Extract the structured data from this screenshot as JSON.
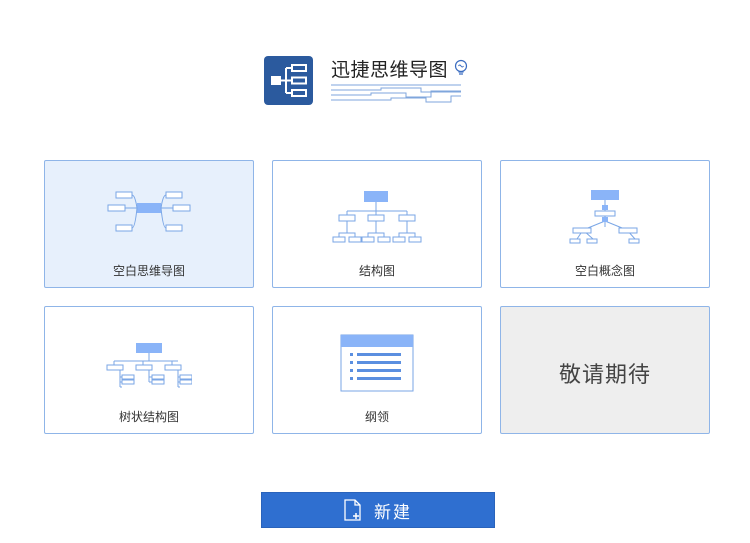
{
  "app": {
    "title": "迅捷思维导图"
  },
  "templates": [
    {
      "label": "空白思维导图"
    },
    {
      "label": "结构图"
    },
    {
      "label": "空白概念图"
    },
    {
      "label": "树状结构图"
    },
    {
      "label": "纲领"
    },
    {
      "label": "敬请期待"
    }
  ],
  "actions": {
    "new_label": "新建"
  },
  "colors": {
    "accent": "#2f6fd0",
    "card_border": "#8fb5e8",
    "thumb_fill": "#8ab4f8",
    "logo_bg": "#2b5a9e"
  }
}
